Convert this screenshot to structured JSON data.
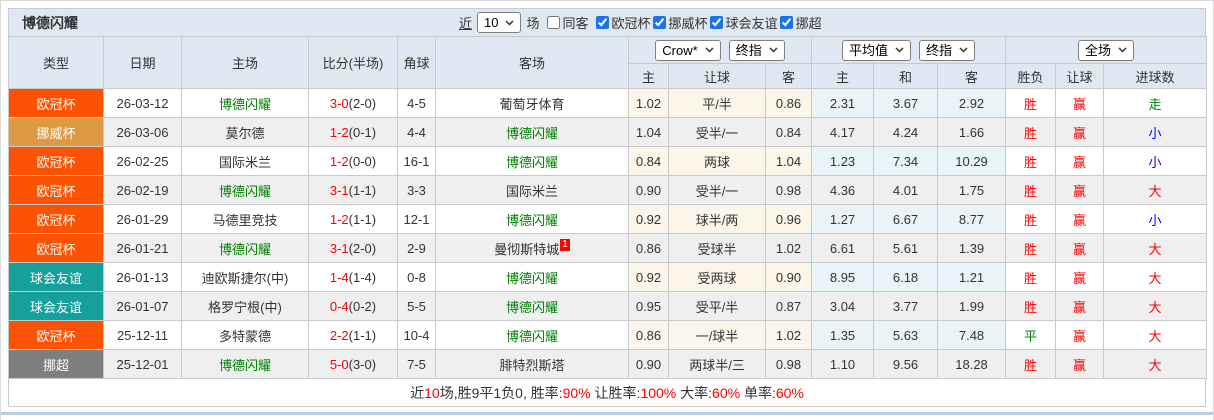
{
  "header": {
    "team": "博德闪耀",
    "recent_label": "近",
    "recent_count": "10",
    "unit_label": "场",
    "same_away": {
      "label": "同客",
      "checked": false
    },
    "league_filters": [
      {
        "label": "欧冠杯",
        "checked": true
      },
      {
        "label": "挪威杯",
        "checked": true
      },
      {
        "label": "球会友谊",
        "checked": true
      },
      {
        "label": "挪超",
        "checked": true
      }
    ]
  },
  "table": {
    "columns": [
      "类型",
      "日期",
      "主场",
      "比分(半场)",
      "角球",
      "客场"
    ],
    "sub_columns": [
      "主",
      "让球",
      "客",
      "主",
      "和",
      "客",
      "胜负",
      "让球",
      "进球数"
    ],
    "selects": {
      "bookmaker": "Crow*",
      "bookmaker_stage": "终指",
      "average": "平均值",
      "average_stage": "终指",
      "scope": "全场"
    },
    "type_colors": {
      "欧冠杯": "#fb5301",
      "挪威杯": "#dd9944",
      "球会友谊": "#16a09c",
      "挪超": "#7e7e7e"
    },
    "team_highlight_color": "#008000",
    "rows": [
      {
        "type": "欧冠杯",
        "date": "26-03-12",
        "home": "博德闪耀",
        "score": "3-0",
        "half": "(2-0)",
        "corners": "4-5",
        "away": "葡萄牙体育",
        "away_sup": "",
        "odds_home": "1.02",
        "handicap": "平/半",
        "odds_away": "0.86",
        "avg_home": "2.31",
        "avg_draw": "3.67",
        "avg_away": "2.92",
        "wdl": "胜",
        "wdl_color": "#ff0000",
        "cover": "赢",
        "cover_color": "#ff0000",
        "goals": "走",
        "goals_color": "#008000"
      },
      {
        "type": "挪威杯",
        "date": "26-03-06",
        "home": "莫尔德",
        "score": "1-2",
        "half": "(0-1)",
        "corners": "4-4",
        "away": "博德闪耀",
        "away_sup": "",
        "odds_home": "1.04",
        "handicap": "受半/一",
        "odds_away": "0.84",
        "avg_home": "4.17",
        "avg_draw": "4.24",
        "avg_away": "1.66",
        "wdl": "胜",
        "wdl_color": "#ff0000",
        "cover": "赢",
        "cover_color": "#ff0000",
        "goals": "小",
        "goals_color": "#0000ff"
      },
      {
        "type": "欧冠杯",
        "date": "26-02-25",
        "home": "国际米兰",
        "score": "1-2",
        "half": "(0-0)",
        "corners": "16-1",
        "away": "博德闪耀",
        "away_sup": "",
        "odds_home": "0.84",
        "handicap": "两球",
        "odds_away": "1.04",
        "avg_home": "1.23",
        "avg_draw": "7.34",
        "avg_away": "10.29",
        "wdl": "胜",
        "wdl_color": "#ff0000",
        "cover": "赢",
        "cover_color": "#ff0000",
        "goals": "小",
        "goals_color": "#0000ff"
      },
      {
        "type": "欧冠杯",
        "date": "26-02-19",
        "home": "博德闪耀",
        "score": "3-1",
        "half": "(1-1)",
        "corners": "3-3",
        "away": "国际米兰",
        "away_sup": "",
        "odds_home": "0.90",
        "handicap": "受半/一",
        "odds_away": "0.98",
        "avg_home": "4.36",
        "avg_draw": "4.01",
        "avg_away": "1.75",
        "wdl": "胜",
        "wdl_color": "#ff0000",
        "cover": "赢",
        "cover_color": "#ff0000",
        "goals": "大",
        "goals_color": "#ff0000"
      },
      {
        "type": "欧冠杯",
        "date": "26-01-29",
        "home": "马德里竞技",
        "score": "1-2",
        "half": "(1-1)",
        "corners": "12-1",
        "away": "博德闪耀",
        "away_sup": "",
        "odds_home": "0.92",
        "handicap": "球半/两",
        "odds_away": "0.96",
        "avg_home": "1.27",
        "avg_draw": "6.67",
        "avg_away": "8.77",
        "wdl": "胜",
        "wdl_color": "#ff0000",
        "cover": "赢",
        "cover_color": "#ff0000",
        "goals": "小",
        "goals_color": "#0000ff"
      },
      {
        "type": "欧冠杯",
        "date": "26-01-21",
        "home": "博德闪耀",
        "score": "3-1",
        "half": "(2-0)",
        "corners": "2-9",
        "away": "曼彻斯特城",
        "away_sup": "1",
        "odds_home": "0.86",
        "handicap": "受球半",
        "odds_away": "1.02",
        "avg_home": "6.61",
        "avg_draw": "5.61",
        "avg_away": "1.39",
        "wdl": "胜",
        "wdl_color": "#ff0000",
        "cover": "赢",
        "cover_color": "#ff0000",
        "goals": "大",
        "goals_color": "#ff0000"
      },
      {
        "type": "球会友谊",
        "date": "26-01-13",
        "home": "迪欧斯捷尔(中)",
        "score": "1-4",
        "half": "(1-4)",
        "corners": "0-8",
        "away": "博德闪耀",
        "away_sup": "",
        "odds_home": "0.92",
        "handicap": "受两球",
        "odds_away": "0.90",
        "avg_home": "8.95",
        "avg_draw": "6.18",
        "avg_away": "1.21",
        "wdl": "胜",
        "wdl_color": "#ff0000",
        "cover": "赢",
        "cover_color": "#ff0000",
        "goals": "大",
        "goals_color": "#ff0000"
      },
      {
        "type": "球会友谊",
        "date": "26-01-07",
        "home": "格罗宁根(中)",
        "score": "0-4",
        "half": "(0-2)",
        "corners": "5-5",
        "away": "博德闪耀",
        "away_sup": "",
        "odds_home": "0.95",
        "handicap": "受平/半",
        "odds_away": "0.87",
        "avg_home": "3.04",
        "avg_draw": "3.77",
        "avg_away": "1.99",
        "wdl": "胜",
        "wdl_color": "#ff0000",
        "cover": "赢",
        "cover_color": "#ff0000",
        "goals": "大",
        "goals_color": "#ff0000"
      },
      {
        "type": "欧冠杯",
        "date": "25-12-11",
        "home": "多特蒙德",
        "score": "2-2",
        "half": "(1-1)",
        "corners": "10-4",
        "away": "博德闪耀",
        "away_sup": "",
        "odds_home": "0.86",
        "handicap": "一/球半",
        "odds_away": "1.02",
        "avg_home": "1.35",
        "avg_draw": "5.63",
        "avg_away": "7.48",
        "wdl": "平",
        "wdl_color": "#008000",
        "cover": "赢",
        "cover_color": "#ff0000",
        "goals": "大",
        "goals_color": "#ff0000"
      },
      {
        "type": "挪超",
        "date": "25-12-01",
        "home": "博德闪耀",
        "score": "5-0",
        "half": "(3-0)",
        "corners": "7-5",
        "away": "腓特烈斯塔",
        "away_sup": "",
        "odds_home": "0.90",
        "handicap": "两球半/三",
        "odds_away": "0.98",
        "avg_home": "1.10",
        "avg_draw": "9.56",
        "avg_away": "18.28",
        "wdl": "胜",
        "wdl_color": "#ff0000",
        "cover": "赢",
        "cover_color": "#ff0000",
        "goals": "大",
        "goals_color": "#ff0000"
      }
    ]
  },
  "footer": {
    "segments": [
      {
        "text": "近",
        "color": "#333333"
      },
      {
        "text": "10",
        "color": "#ff0000"
      },
      {
        "text": "场,胜9平1负0, 胜率:",
        "color": "#333333"
      },
      {
        "text": "90%",
        "color": "#ff0000"
      },
      {
        "text": " 让胜率:",
        "color": "#333333"
      },
      {
        "text": "100%",
        "color": "#ff0000"
      },
      {
        "text": " 大率:",
        "color": "#333333"
      },
      {
        "text": "60%",
        "color": "#ff0000"
      },
      {
        "text": " 单率:",
        "color": "#333333"
      },
      {
        "text": "60%",
        "color": "#ff0000"
      }
    ]
  }
}
